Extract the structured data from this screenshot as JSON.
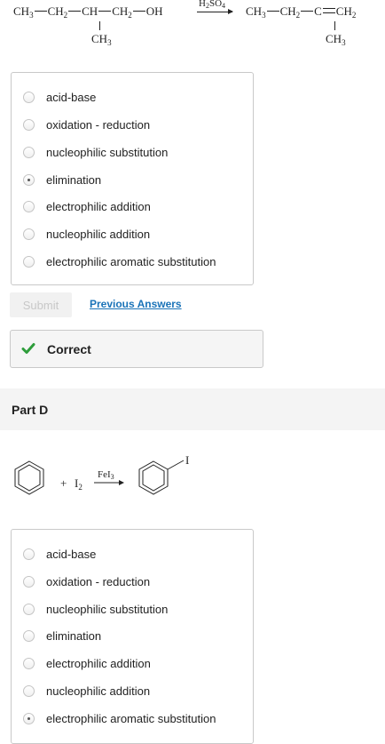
{
  "reaction1": {
    "reactant": {
      "c1": "CH",
      "c1_sub": "3",
      "c2": "CH",
      "c2_sub": "2",
      "c3": "CH",
      "c4": "CH",
      "c4_sub": "2",
      "oh": "OH",
      "branch": "CH",
      "branch_sub": "3"
    },
    "reagent": "H",
    "reagent_sub1": "2",
    "reagent_mid": "SO",
    "reagent_sub2": "4",
    "product": {
      "c1": "CH",
      "c1_sub": "3",
      "c2": "CH",
      "c2_sub": "2",
      "c3": "C",
      "c4": "CH",
      "c4_sub": "2",
      "branch": "CH",
      "branch_sub": "3"
    }
  },
  "part_c_options": [
    {
      "label": "acid-base",
      "checked": false
    },
    {
      "label": "oxidation - reduction",
      "checked": false
    },
    {
      "label": "nucleophilic substitution",
      "checked": false
    },
    {
      "label": "elimination",
      "checked": true
    },
    {
      "label": "electrophilic addition",
      "checked": false
    },
    {
      "label": "nucleophilic addition",
      "checked": false
    },
    {
      "label": "electrophilic aromatic substitution",
      "checked": false
    }
  ],
  "actions": {
    "submit_label": "Submit",
    "previous_answers_label": "Previous Answers"
  },
  "feedback": {
    "status_text": "Correct",
    "status_color": "#2e9d3b"
  },
  "part_d": {
    "title": "Part D",
    "reaction": {
      "plus": "+",
      "reagent": "I",
      "reagent_sub": "2",
      "catalyst": "FeI",
      "catalyst_sub": "3",
      "product_substituent": "I"
    },
    "options": [
      {
        "label": "acid-base",
        "checked": false
      },
      {
        "label": "oxidation - reduction",
        "checked": false
      },
      {
        "label": "nucleophilic substitution",
        "checked": false
      },
      {
        "label": "elimination",
        "checked": false
      },
      {
        "label": "electrophilic addition",
        "checked": false
      },
      {
        "label": "nucleophilic addition",
        "checked": false
      },
      {
        "label": "electrophilic aromatic substitution",
        "checked": true
      }
    ]
  }
}
